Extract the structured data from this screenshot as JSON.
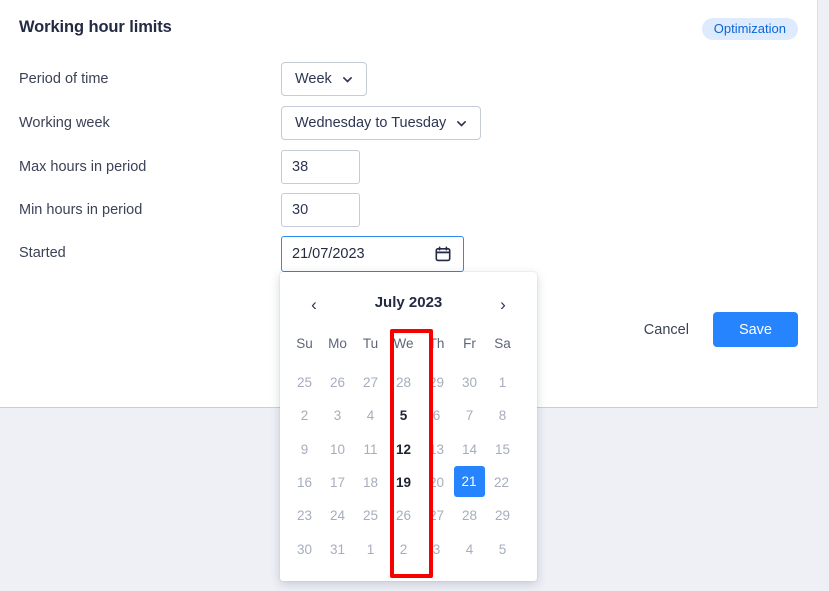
{
  "header": {
    "title": "Working hour limits",
    "badge": "Optimization"
  },
  "form": {
    "rows": [
      {
        "label": "Period of time",
        "type": "select",
        "value": "Week"
      },
      {
        "label": "Working week",
        "type": "select",
        "value": "Wednesday to Tuesday"
      },
      {
        "label": "Max hours in period",
        "type": "number",
        "value": "38"
      },
      {
        "label": "Min hours in period",
        "type": "number",
        "value": "30"
      },
      {
        "label": "Started",
        "type": "date",
        "value": "21/07/2023"
      }
    ]
  },
  "actions": {
    "cancel_label": "Cancel",
    "save_label": "Save"
  },
  "calendar": {
    "month_label": "July 2023",
    "prev_label": "‹",
    "next_label": "›",
    "weekdays": [
      "Su",
      "Mo",
      "Tu",
      "We",
      "Th",
      "Fr",
      "Sa"
    ],
    "highlighted_column_index": 3,
    "selected_day": "21",
    "weeks": [
      [
        {
          "d": "25",
          "out": true
        },
        {
          "d": "26",
          "out": true
        },
        {
          "d": "27",
          "out": true
        },
        {
          "d": "28",
          "out": true
        },
        {
          "d": "29",
          "out": true
        },
        {
          "d": "30",
          "out": true
        },
        {
          "d": "1",
          "out": false
        }
      ],
      [
        {
          "d": "2",
          "out": false
        },
        {
          "d": "3",
          "out": false
        },
        {
          "d": "4",
          "out": false
        },
        {
          "d": "5",
          "out": false
        },
        {
          "d": "6",
          "out": false
        },
        {
          "d": "7",
          "out": false
        },
        {
          "d": "8",
          "out": false
        }
      ],
      [
        {
          "d": "9",
          "out": false
        },
        {
          "d": "10",
          "out": false
        },
        {
          "d": "11",
          "out": false
        },
        {
          "d": "12",
          "out": false
        },
        {
          "d": "13",
          "out": false
        },
        {
          "d": "14",
          "out": false
        },
        {
          "d": "15",
          "out": false
        }
      ],
      [
        {
          "d": "16",
          "out": false
        },
        {
          "d": "17",
          "out": false
        },
        {
          "d": "18",
          "out": false
        },
        {
          "d": "19",
          "out": false
        },
        {
          "d": "20",
          "out": false
        },
        {
          "d": "21",
          "out": false,
          "selected": true
        },
        {
          "d": "22",
          "out": false
        }
      ],
      [
        {
          "d": "23",
          "out": false
        },
        {
          "d": "24",
          "out": false
        },
        {
          "d": "25",
          "out": false
        },
        {
          "d": "26",
          "out": true
        },
        {
          "d": "27",
          "out": false
        },
        {
          "d": "28",
          "out": false
        },
        {
          "d": "29",
          "out": false
        }
      ],
      [
        {
          "d": "30",
          "out": false
        },
        {
          "d": "31",
          "out": false
        },
        {
          "d": "1",
          "out": true
        },
        {
          "d": "2",
          "out": true
        },
        {
          "d": "3",
          "out": true
        },
        {
          "d": "4",
          "out": true
        },
        {
          "d": "5",
          "out": true
        }
      ]
    ]
  },
  "colors": {
    "accent": "#2684ff",
    "badge_bg": "#deebff",
    "badge_text": "#0a66d6",
    "annotation": "#f60000",
    "page_bg": "#eef0f6"
  }
}
